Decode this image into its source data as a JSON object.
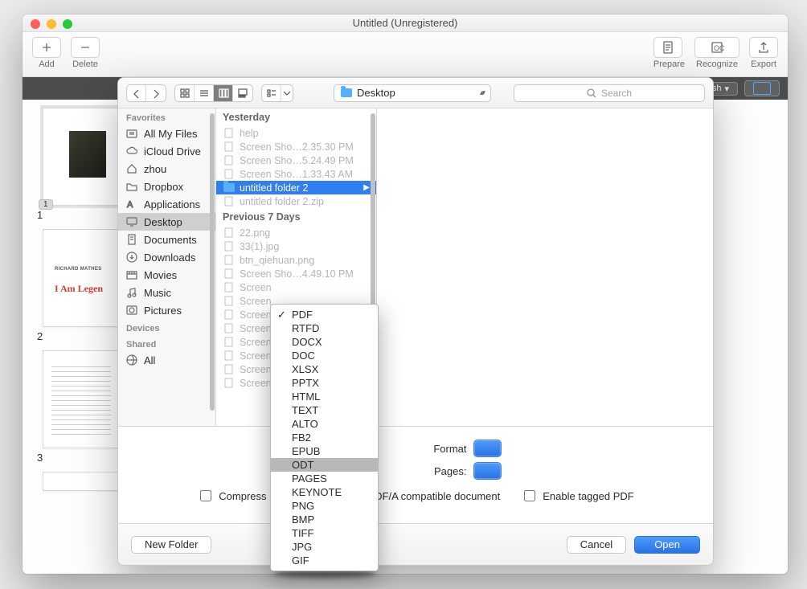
{
  "window": {
    "title": "Untitled (Unregistered)"
  },
  "toolbar": {
    "add": "Add",
    "delete": "Delete",
    "prepare": "Prepare",
    "recognize": "Recognize",
    "export": "Export"
  },
  "darkbar": {
    "dropdown_suffix": "sh"
  },
  "thumbs": {
    "pages": [
      "1",
      "2",
      "3"
    ],
    "pagebadge": "1",
    "legend_title": "I Am Legen",
    "legend_author": "RICHARD MATHES"
  },
  "sheet": {
    "path_label": "Desktop",
    "search_placeholder": "Search",
    "sidebar": {
      "headers": {
        "favorites": "Favorites",
        "devices": "Devices",
        "shared": "Shared"
      },
      "favorites": [
        {
          "label": "All My Files",
          "icon": "all-files"
        },
        {
          "label": "iCloud Drive",
          "icon": "icloud"
        },
        {
          "label": "zhou",
          "icon": "home"
        },
        {
          "label": "Dropbox",
          "icon": "folder"
        },
        {
          "label": "Applications",
          "icon": "apps"
        },
        {
          "label": "Desktop",
          "icon": "desktop",
          "selected": true
        },
        {
          "label": "Documents",
          "icon": "documents"
        },
        {
          "label": "Downloads",
          "icon": "downloads"
        },
        {
          "label": "Movies",
          "icon": "movies"
        },
        {
          "label": "Music",
          "icon": "music"
        },
        {
          "label": "Pictures",
          "icon": "pictures"
        }
      ],
      "shared_item": "All"
    },
    "files": {
      "group1": "Yesterday",
      "list1": [
        "help",
        "Screen Sho…2.35.30 PM",
        "Screen Sho…5.24.49 PM",
        "Screen Sho…1.33.43 AM"
      ],
      "selected_folder": "untitled folder 2",
      "zipname": "untitled folder 2.zip",
      "group2": "Previous 7 Days",
      "list2": [
        "22.png",
        "33(1).jpg",
        "btn_qiehuan.png",
        "Screen Sho…4.49.10 PM",
        "Screen",
        "Screen",
        "Screen",
        "Screen",
        "Screen",
        "Screen",
        "Screen",
        "Screen"
      ]
    },
    "options": {
      "format_label": "Format",
      "pages_label": "Pages:",
      "compress_label": "Compress images usin",
      "pdfa_label": "PDF/A compatible document",
      "tagged_label": "Enable tagged PDF"
    },
    "footer": {
      "new_folder": "New Folder",
      "cancel": "Cancel",
      "open": "Open"
    }
  },
  "popup": {
    "items": [
      "PDF",
      "RTFD",
      "DOCX",
      "DOC",
      "XLSX",
      "PPTX",
      "HTML",
      "TEXT",
      "ALTO",
      "FB2",
      "EPUB",
      "ODT",
      "PAGES",
      "KEYNOTE",
      "PNG",
      "BMP",
      "TIFF",
      "JPG",
      "GIF"
    ],
    "checked": "PDF",
    "selected": "ODT"
  }
}
